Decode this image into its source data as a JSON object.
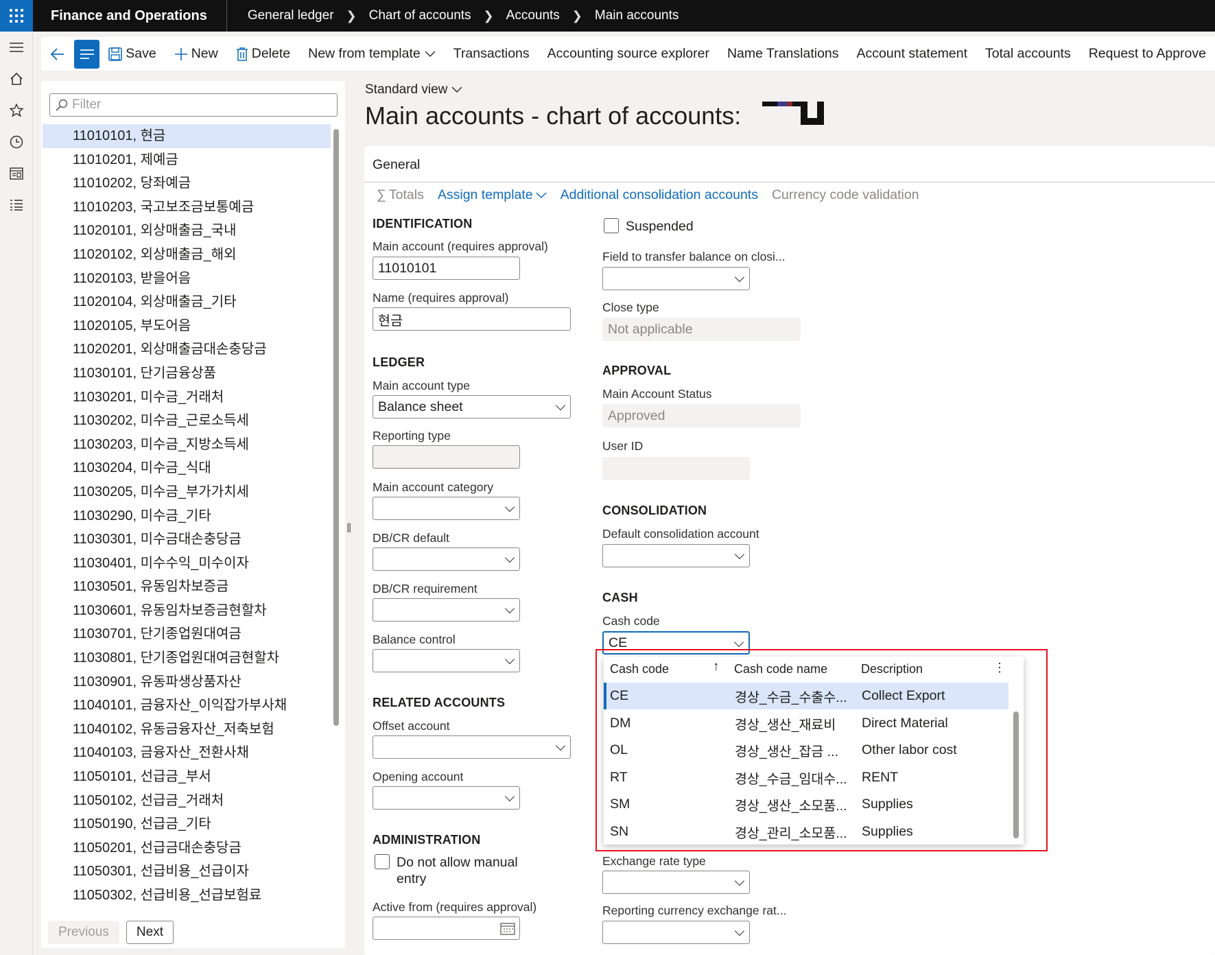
{
  "app": {
    "title": "Finance and Operations"
  },
  "breadcrumb": [
    "General ledger",
    "Chart of accounts",
    "Accounts",
    "Main accounts"
  ],
  "actions": {
    "save": "Save",
    "new": "New",
    "delete": "Delete",
    "new_from_template": "New from template",
    "transactions": "Transactions",
    "accounting_source_explorer": "Accounting source explorer",
    "name_translations": "Name Translations",
    "account_statement": "Account statement",
    "total_accounts": "Total accounts",
    "request_to_approve": "Request to Approve"
  },
  "list": {
    "filter_placeholder": "Filter",
    "items": [
      "11010101, 현금",
      "11010201, 제예금",
      "11010202, 당좌예금",
      "11010203, 국고보조금보통예금",
      "11020101, 외상매출금_국내",
      "11020102, 외상매출금_해외",
      "11020103, 받을어음",
      "11020104, 외상매출금_기타",
      "11020105, 부도어음",
      "11020201, 외상매출금대손충당금",
      "11030101, 단기금융상품",
      "11030201, 미수금_거래처",
      "11030202, 미수금_근로소득세",
      "11030203, 미수금_지방소득세",
      "11030204, 미수금_식대",
      "11030205, 미수금_부가가치세",
      "11030290, 미수금_기타",
      "11030301, 미수금대손충당금",
      "11030401, 미수수익_미수이자",
      "11030501, 유동임차보증금",
      "11030601, 유동임차보증금현할차",
      "11030701, 단기종업원대여금",
      "11030801, 단기종업원대여금현할차",
      "11030901, 유동파생상품자산",
      "11040101, 금융자산_이익잡가부사채",
      "11040102, 유동금융자산_저축보험",
      "11040103, 금융자산_전환사채",
      "11050101, 선급금_부서",
      "11050102, 선급금_거래처",
      "11050190, 선급금_기타",
      "11050201, 선급금대손충당금",
      "11050301, 선급비용_선급이자",
      "11050302, 선급비용_선급보험료"
    ],
    "previous": "Previous",
    "next": "Next"
  },
  "view": {
    "name": "Standard view"
  },
  "page_title": "Main accounts - chart of accounts:",
  "card": {
    "title": "General",
    "tabs": {
      "totals": "Totals",
      "assign_template": "Assign template",
      "additional_consolidation": "Additional consolidation accounts",
      "currency_code_validation": "Currency code validation"
    }
  },
  "form": {
    "identification": "IDENTIFICATION",
    "main_account_label": "Main account (requires approval)",
    "main_account_value": "11010101",
    "name_label": "Name (requires approval)",
    "name_value": "현금",
    "ledger": "LEDGER",
    "main_account_type_label": "Main account type",
    "main_account_type_value": "Balance sheet",
    "reporting_type_label": "Reporting type",
    "main_account_category_label": "Main account category",
    "dbcr_default_label": "DB/CR default",
    "dbcr_requirement_label": "DB/CR requirement",
    "balance_control_label": "Balance control",
    "related_accounts": "RELATED ACCOUNTS",
    "offset_account_label": "Offset account",
    "opening_account_label": "Opening account",
    "administration": "ADMINISTRATION",
    "do_not_allow_manual_entry": "Do not allow manual",
    "do_not_allow_manual_entry_2": "entry",
    "active_from_label": "Active from (requires approval)",
    "suspended": "Suspended",
    "field_transfer_label": "Field to transfer balance on closi...",
    "close_type_label": "Close type",
    "close_type_value": "Not applicable",
    "approval": "APPROVAL",
    "main_account_status_label": "Main Account Status",
    "main_account_status_value": "Approved",
    "user_id_label": "User ID",
    "consolidation": "CONSOLIDATION",
    "default_consolidation_label": "Default consolidation account",
    "cash": "CASH",
    "cash_code_label": "Cash code",
    "cash_code_value": "CE",
    "exchange_rate_type_label": "Exchange rate type",
    "reporting_currency_label": "Reporting currency exchange rat..."
  },
  "lookup": {
    "headers": {
      "code": "Cash code",
      "name": "Cash code name",
      "description": "Description"
    },
    "rows": [
      {
        "code": "CE",
        "name": "경상_수금_수출수...",
        "description": "Collect Export"
      },
      {
        "code": "DM",
        "name": "경상_생산_재료비",
        "description": "Direct Material"
      },
      {
        "code": "OL",
        "name": "경상_생산_잡금 ...",
        "description": "Other labor cost"
      },
      {
        "code": "RT",
        "name": "경상_수금_임대수...",
        "description": "RENT"
      },
      {
        "code": "SM",
        "name": "경상_생산_소모품...",
        "description": "Supplies"
      },
      {
        "code": "SN",
        "name": "경상_관리_소모품...",
        "description": "Supplies"
      }
    ]
  },
  "colors": {
    "accent": "#0f6cbd",
    "highlight": "#e81123",
    "selected_row": "#dbe6fa"
  }
}
